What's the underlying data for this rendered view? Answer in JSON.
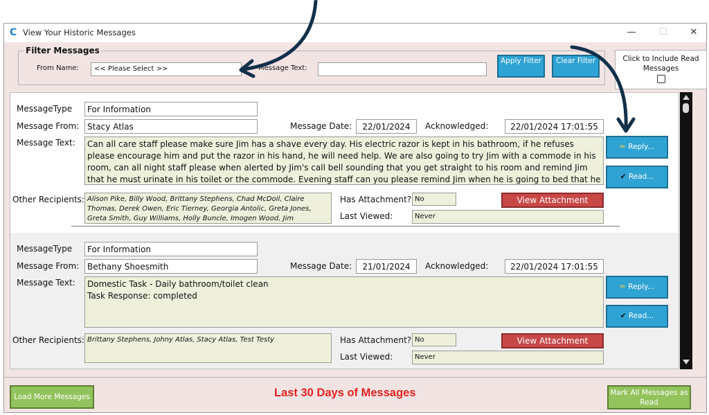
{
  "window": {
    "title": "View Your Historic Messages",
    "min_glyph": "—",
    "max_glyph": "☐",
    "close_glyph": "✕"
  },
  "filter": {
    "legend": "Filter Messages",
    "from_label": "From Name:",
    "from_value": "<< Please Select >>",
    "text_label": "Message Text:",
    "text_value": "",
    "apply_label": "Apply Filter",
    "clear_label": "Clear Filter",
    "include_read_label": "Click to Include Read Messages",
    "include_read_checked": false
  },
  "labels": {
    "type": "MessageType",
    "from": "Message From:",
    "text": "Message Text:",
    "recipients": "Other Recipients:",
    "date": "Message Date:",
    "acknowledged": "Acknowledged:",
    "has_attachment": "Has Attachment?:",
    "last_viewed": "Last Viewed:",
    "reply": "Reply...",
    "read": "Read...",
    "view_attachment": "View Attachment"
  },
  "messages": [
    {
      "type": "For Information",
      "from": "Stacy Atlas",
      "date": "22/01/2024",
      "acknowledged": "22/01/2024 17:01:55",
      "text": "Can all care staff please make sure Jim has a shave every day. His electric razor is kept in his bathroom, if he refuses please encourage him and put the razor in his hand, he will need help. We are also going to try Jim with a commode in his room, can all night staff please when alerted by Jim's call bell sounding that you get straight to his room and remind Jim that he must urinate in his toilet or the commode. Evening staff can you please remind Jim when he is going to  bed that he must keep his",
      "recipients": "Alison Pike, Billy Wood, Brittany Stephens, Chad McDoil, Claire Thomas, Derek Owen, Eric Tierney, Georgia Antolic, Greta Jones, Greta Smith, Guy Williams, Holly Buncle, Imogen Wood, Jim",
      "has_attachment": "No",
      "last_viewed": "Never"
    },
    {
      "type": "For Information",
      "from": "Bethany Shoesmith",
      "date": "21/01/2024",
      "acknowledged": "22/01/2024 17:01:55",
      "text_line1": "Domestic Task - Daily bathroom/toilet clean",
      "text_line2": "Task Response: completed",
      "recipients": "Brittany Stephens, Johny Atlas, Stacy Atlas, Test Testy",
      "has_attachment": "No",
      "last_viewed": "Never"
    }
  ],
  "footer": {
    "load_more": "Load More Messages",
    "title": "Last 30 Days of Messages",
    "mark_all": "Mark All Messages as Read"
  },
  "colors": {
    "window_bg": "#f3e4e4",
    "accent_blue": "#2fa3d4",
    "accent_red": "#c84848",
    "accent_green": "#93c35c",
    "title_red": "#e8231f",
    "arrow": "#10304a"
  }
}
